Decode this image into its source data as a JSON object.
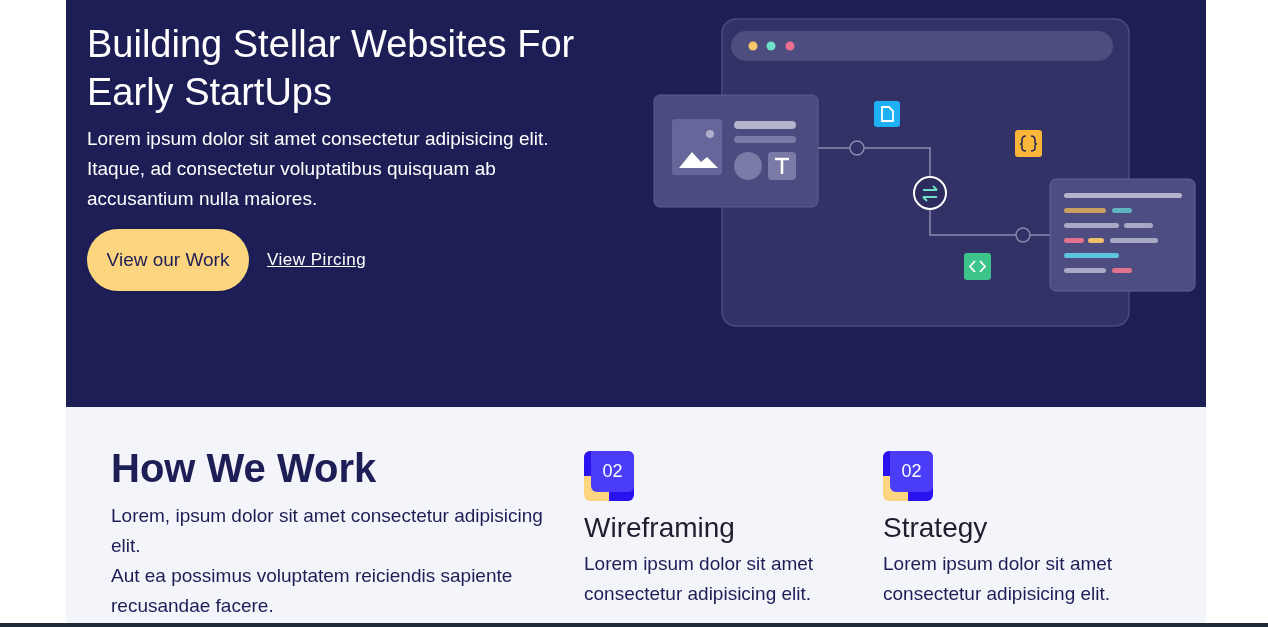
{
  "hero": {
    "title": "Building Stellar Websites For Early StartUps",
    "text": "Lorem ipsum dolor sit amet consectetur adipisicing elit. Itaque, ad consectetur voluptatibus quisquam ab accusantium nulla maiores.",
    "primary_button": "View our Work",
    "link": "View Pircing"
  },
  "how": {
    "title": "How We Work",
    "paragraphs": [
      "Lorem, ipsum dolor sit amet consectetur adipisicing elit.",
      "Aut ea possimus voluptatem reiciendis sapiente recusandae facere."
    ]
  },
  "steps": [
    {
      "number": "02",
      "title": "Wireframing",
      "text": "Lorem ipsum dolor sit amet consectetur adipisicing elit."
    },
    {
      "number": "02",
      "title": "Strategy",
      "text": "Lorem ipsum dolor sit amet consectetur adipisicing elit."
    }
  ]
}
